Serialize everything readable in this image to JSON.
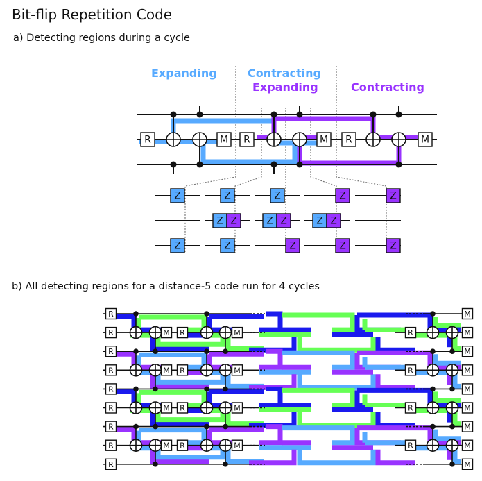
{
  "title": "Bit-flip Repetition Code",
  "panel_a": {
    "caption": "a) Detecting regions during a cycle",
    "labels": [
      {
        "text": "Expanding",
        "color_key": "blue"
      },
      {
        "text": "Contracting",
        "color_key": "blue"
      },
      {
        "text": "Expanding",
        "color_key": "purple"
      },
      {
        "text": "Contracting",
        "color_key": "purple"
      }
    ],
    "gates": {
      "reset": "R",
      "measure": "M",
      "pauli": "Z"
    },
    "circuit_sequence": [
      "R",
      "CNOT",
      "CNOT",
      "M",
      "R",
      "CNOT",
      "CNOT",
      "M",
      "R",
      "CNOT",
      "CNOT",
      "M"
    ],
    "pauli_snapshots": [
      {
        "top": [
          "blue"
        ],
        "middle": [],
        "bottom": [
          "blue"
        ]
      },
      {
        "top": [
          "blue"
        ],
        "middle": [
          "blue",
          "purple"
        ],
        "bottom": [
          "blue"
        ]
      },
      {
        "top": [
          "blue"
        ],
        "middle": [
          "blue",
          "purple"
        ],
        "bottom": [
          "purple"
        ]
      },
      {
        "top": [
          "purple"
        ],
        "middle": [
          "blue",
          "purple"
        ],
        "bottom": [
          "purple"
        ]
      },
      {
        "top": [
          "purple"
        ],
        "middle": [],
        "bottom": [
          "purple"
        ]
      }
    ]
  },
  "panel_b": {
    "caption": "b) All detecting regions for a distance-5 code run for 4 cycles",
    "data_qubits": 5,
    "measure_qubits": 4,
    "cycles": 4,
    "reset_label": "R",
    "measure_label": "M",
    "ellipsis": "····"
  },
  "colors": {
    "blue": "#57aaff",
    "purple": "#9933ff",
    "dark_blue": "#1a1aee",
    "green": "#66ff55",
    "wire": "#111111",
    "gate_fill": "#ffffff",
    "guide": "#777777"
  }
}
